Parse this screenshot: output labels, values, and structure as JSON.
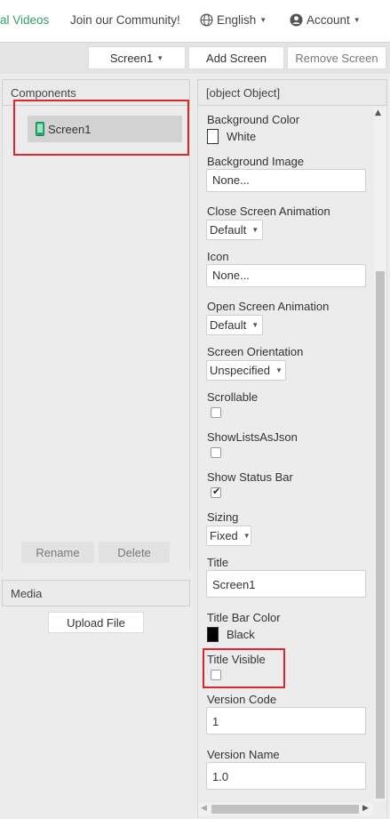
{
  "nav": {
    "tutorial_label": "al Videos",
    "community_label": "Join our Community!",
    "language_label": "English",
    "account_label": "Account"
  },
  "toolbar": {
    "screen_select": "Screen1",
    "add_screen": "Add Screen",
    "remove_screen": "Remove Screen"
  },
  "components": {
    "title": "Components",
    "tree": [
      {
        "label": "Screen1",
        "icon": "phone-icon"
      }
    ],
    "rename": "Rename",
    "delete": "Delete"
  },
  "media": {
    "title": "Media",
    "upload": "Upload File"
  },
  "properties": {
    "title": {
      "label": "Title",
      "value": "Screen1"
    },
    "background_color": {
      "label": "Background Color",
      "value": "White",
      "swatch": "#ffffff"
    },
    "background_image": {
      "label": "Background Image",
      "value": "None..."
    },
    "close_screen_animation": {
      "label": "Close Screen Animation",
      "value": "Default"
    },
    "icon": {
      "label": "Icon",
      "value": "None..."
    },
    "open_screen_animation": {
      "label": "Open Screen Animation",
      "value": "Default"
    },
    "screen_orientation": {
      "label": "Screen Orientation",
      "value": "Unspecified"
    },
    "scrollable": {
      "label": "Scrollable",
      "checked": false
    },
    "show_lists_as_json": {
      "label": "ShowListsAsJson",
      "checked": false
    },
    "show_status_bar": {
      "label": "Show Status Bar",
      "checked": true
    },
    "sizing": {
      "label": "Sizing",
      "value": "Fixed"
    },
    "title_bar_color": {
      "label": "Title Bar Color",
      "value": "Black",
      "swatch": "#000000"
    },
    "title_visible": {
      "label": "Title Visible",
      "checked": false
    },
    "version_code": {
      "label": "Version Code",
      "value": "1"
    },
    "version_name": {
      "label": "Version Name",
      "value": "1.0"
    }
  },
  "colors": {
    "accent_green": "#2fa06b",
    "highlight_red": "#e0262b",
    "phone_icon": "#2bb673"
  }
}
